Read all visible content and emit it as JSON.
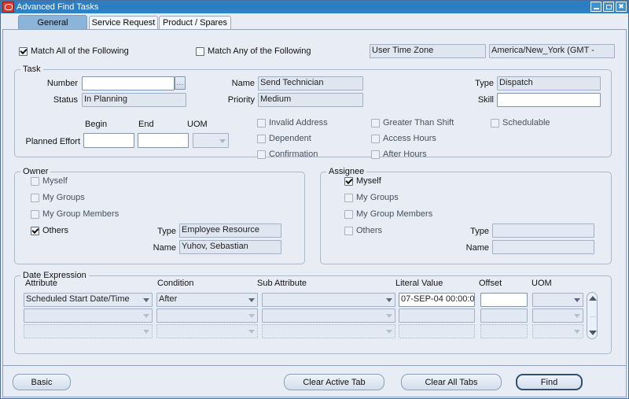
{
  "window": {
    "title": "Advanced Find Tasks",
    "icon": "oracle-forms-icon",
    "controls": {
      "minimize": "minimize-icon",
      "maximize": "maximize-icon",
      "close": "close-icon"
    }
  },
  "tabs": [
    {
      "label": "General",
      "active": true
    },
    {
      "label": "Service Request",
      "active": false
    },
    {
      "label": "Product / Spares",
      "active": false
    }
  ],
  "match": {
    "all_label": "Match All of the Following",
    "all_checked": true,
    "any_label": "Match Any of the Following",
    "any_checked": false,
    "timezone_label_value": "User Time Zone",
    "timezone_value": "America/New_York (GMT -"
  },
  "task": {
    "group_title": "Task",
    "number_label": "Number",
    "number_value": "",
    "lov_glyph": "...",
    "status_label": "Status",
    "status_value": "In Planning",
    "name_label": "Name",
    "name_value": "Send Technician",
    "priority_label": "Priority",
    "priority_value": "Medium",
    "type_label": "Type",
    "type_value": "Dispatch",
    "skill_label": "Skill",
    "skill_value": "",
    "begin_label": "Begin",
    "end_label": "End",
    "uom_label": "UOM",
    "planned_effort_label": "Planned Effort",
    "begin_value": "",
    "end_value": "",
    "uom_value": "",
    "checkboxes": [
      {
        "label": "Invalid Address",
        "checked": false
      },
      {
        "label": "Dependent",
        "checked": false
      },
      {
        "label": "Confirmation",
        "checked": false
      },
      {
        "label": "Greater Than Shift",
        "checked": false
      },
      {
        "label": "Access Hours",
        "checked": false
      },
      {
        "label": "After Hours",
        "checked": false
      },
      {
        "label": "Schedulable",
        "checked": false
      }
    ]
  },
  "owner": {
    "group_title": "Owner",
    "options": [
      {
        "label": "Myself",
        "checked": false
      },
      {
        "label": "My Groups",
        "checked": false
      },
      {
        "label": "My Group Members",
        "checked": false
      },
      {
        "label": "Others",
        "checked": true
      }
    ],
    "type_label": "Type",
    "type_value": "Employee Resource",
    "name_label": "Name",
    "name_value": "Yuhov, Sebastian"
  },
  "assignee": {
    "group_title": "Assignee",
    "options": [
      {
        "label": "Myself",
        "checked": true
      },
      {
        "label": "My Groups",
        "checked": false
      },
      {
        "label": "My Group Members",
        "checked": false
      },
      {
        "label": "Others",
        "checked": false
      }
    ],
    "type_label": "Type",
    "type_value": "",
    "name_label": "Name",
    "name_value": ""
  },
  "date_expression": {
    "group_title": "Date Expression",
    "headers": {
      "attribute": "Attribute",
      "condition": "Condition",
      "sub_attribute": "Sub Attribute",
      "literal_value": "Literal Value",
      "offset": "Offset",
      "uom": "UOM"
    },
    "rows": [
      {
        "attribute": "Scheduled Start Date/Time",
        "condition": "After",
        "sub_attribute": "",
        "literal_value": "07-SEP-04 00:00:0",
        "offset": "",
        "uom": ""
      },
      {
        "attribute": "",
        "condition": "",
        "sub_attribute": "",
        "literal_value": "",
        "offset": "",
        "uom": ""
      },
      {
        "attribute": "",
        "condition": "",
        "sub_attribute": "",
        "literal_value": "",
        "offset": "",
        "uom": ""
      }
    ],
    "scrollbar": {
      "up": "scroll-up-arrow",
      "down": "scroll-down-arrow"
    }
  },
  "footer": {
    "basic_label": "Basic",
    "clear_active_label": "Clear Active Tab",
    "clear_all_label": "Clear All Tabs",
    "find_label": "Find"
  },
  "colors": {
    "titlebar": "#2b7bbf",
    "panel_bg": "#e8edf5",
    "active_tab": "#8bb4d8",
    "field_border": "#9fb1c6"
  }
}
